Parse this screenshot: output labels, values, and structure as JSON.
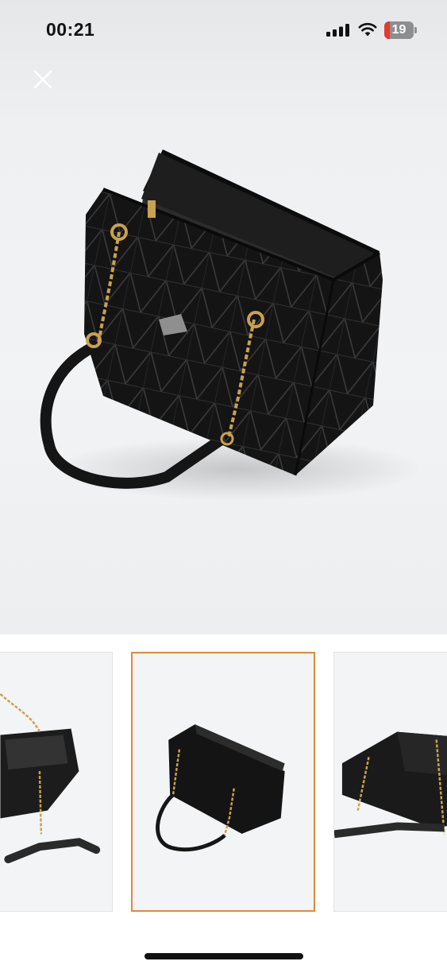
{
  "status_bar": {
    "time": "00:21",
    "battery_level": 19,
    "battery_label": "19",
    "battery_color": "#e33b2e",
    "icons": [
      "cellular-signal-icon",
      "wifi-icon",
      "battery-icon"
    ]
  },
  "viewer": {
    "close_icon": "close-icon",
    "selected_thumbnail_index": 1,
    "thumbnail_count": 3,
    "accent_color": "#e08a3c"
  }
}
